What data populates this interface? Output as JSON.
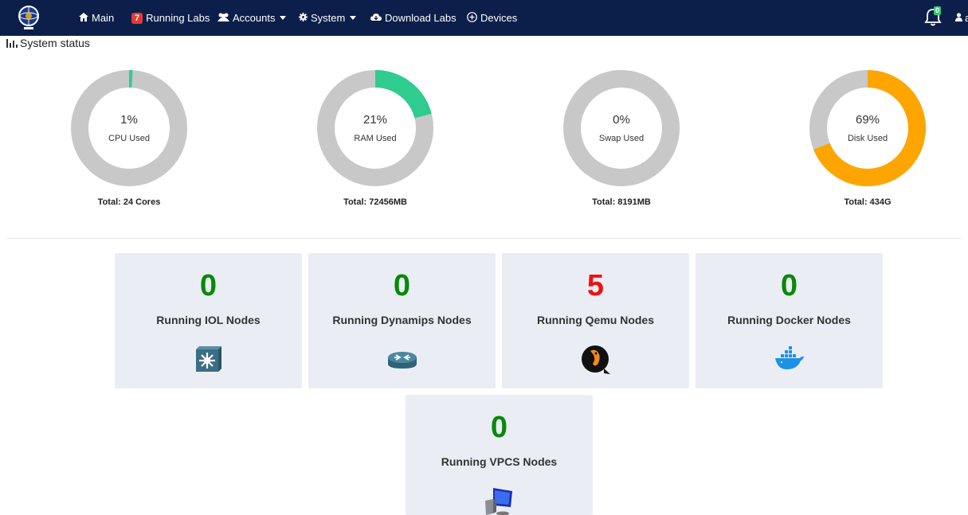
{
  "nav": {
    "items": [
      {
        "icon": "home-icon",
        "label": "Main"
      },
      {
        "icon": "running-labs-badge",
        "badge": "7",
        "label": "Running Labs"
      },
      {
        "icon": "users-icon",
        "label": "Accounts"
      },
      {
        "icon": "gear-icon",
        "label": "System"
      },
      {
        "icon": "cloud-download-icon",
        "label": "Download Labs"
      },
      {
        "icon": "plus-circle-icon",
        "label": "Devices"
      }
    ],
    "notification_count": "0",
    "user_label": "a"
  },
  "system_status": {
    "title": "System status",
    "gauges": [
      {
        "value": "1%",
        "label": "CPU Used",
        "total": "Total: 24 Cores",
        "percent": 1,
        "color": "#2ecc8e"
      },
      {
        "value": "21%",
        "label": "RAM Used",
        "total": "Total: 72456MB",
        "percent": 21,
        "color": "#2ecc8e"
      },
      {
        "value": "0%",
        "label": "Swap Used",
        "total": "Total: 8191MB",
        "percent": 0,
        "color": "#2ecc8e"
      },
      {
        "value": "69%",
        "label": "Disk Used",
        "total": "Total: 434G",
        "percent": 69,
        "color": "#ffa500"
      }
    ],
    "track_color": "#c8c8c8"
  },
  "nodes": [
    {
      "count": "0",
      "title": "Running IOL Nodes",
      "icon": "switch-icon"
    },
    {
      "count": "0",
      "title": "Running Dynamips Nodes",
      "icon": "router-icon"
    },
    {
      "count": "5",
      "title": "Running Qemu Nodes",
      "icon": "qemu-icon",
      "highlight": true
    },
    {
      "count": "0",
      "title": "Running Docker Nodes",
      "icon": "docker-icon"
    },
    {
      "count": "0",
      "title": "Running VPCS Nodes",
      "icon": "computer-icon"
    }
  ],
  "colors": {
    "navbar": "#0b1f4a",
    "count_green": "#078a07",
    "count_red": "#ee1111",
    "card_bg": "#eaeef4"
  }
}
